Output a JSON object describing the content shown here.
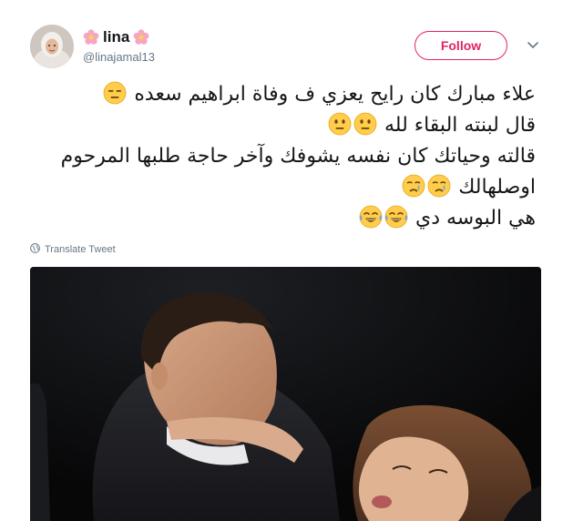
{
  "header": {
    "display_name": "lina",
    "handle": "@linajamal13",
    "follow_label": "Follow",
    "name_emoji_icon": "cherry-blossom-icon"
  },
  "tweet": {
    "lines": [
      "علاء مبارك كان رايح يعزي ف وفاة ابراهيم سعده",
      "قال لبنته البقاء لله",
      "قالته وحياتك كان نفسه يشوفك وآخر حاجة طلبها المرحوم",
      "اوصلهالك",
      "هي البوسه دي"
    ],
    "emojis": {
      "line1": "expressionless-face-icon",
      "line2": "neutral-face-icon",
      "line4": "crying-face-icon",
      "line5": "tears-of-joy-face-icon"
    }
  },
  "translate_label": "Translate Tweet",
  "colors": {
    "follow": "#e0245e",
    "secondary_text": "#657786",
    "primary_text": "#14171a"
  }
}
